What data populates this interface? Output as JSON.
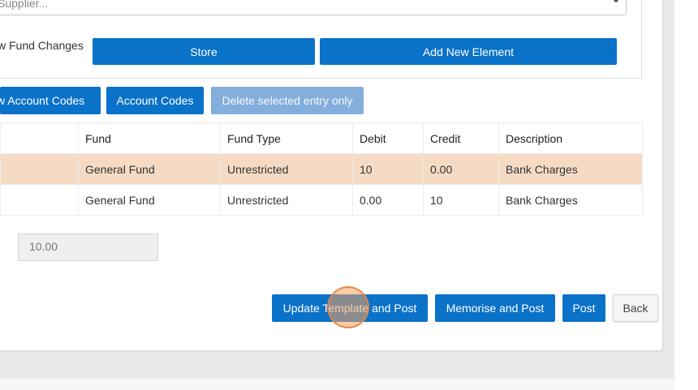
{
  "form": {
    "supplier_placeholder": "Supplier...",
    "fund_changes_label": "w Fund Changes",
    "store_label": "Store",
    "add_element_label": "Add New Element"
  },
  "toolbar": {
    "new_account_codes_label": "w Account Codes",
    "account_codes_label": "Account Codes",
    "delete_selected_label": "Delete selected entry only"
  },
  "table": {
    "headers": [
      "",
      "Fund",
      "Fund Type",
      "Debit",
      "Credit",
      "Description"
    ],
    "rows": [
      {
        "fund": "General Fund",
        "fund_type": "Unrestricted",
        "debit": "10",
        "credit": "0.00",
        "description": "Bank Charges",
        "selected": true
      },
      {
        "fund": "General Fund",
        "fund_type": "Unrestricted",
        "debit": "0.00",
        "credit": "10",
        "description": "Bank Charges",
        "selected": false
      }
    ]
  },
  "total_value": "10.00",
  "actions": {
    "update_template_post": "Update Template and Post",
    "memorise_post": "Memorise and Post",
    "post": "Post",
    "back": "Back"
  },
  "colors": {
    "primary": "#0a72c9",
    "disabled": "#84aedb",
    "selected_row": "#f5dbc4"
  },
  "icons": {
    "select_chevron": "chevron-down-icon"
  }
}
